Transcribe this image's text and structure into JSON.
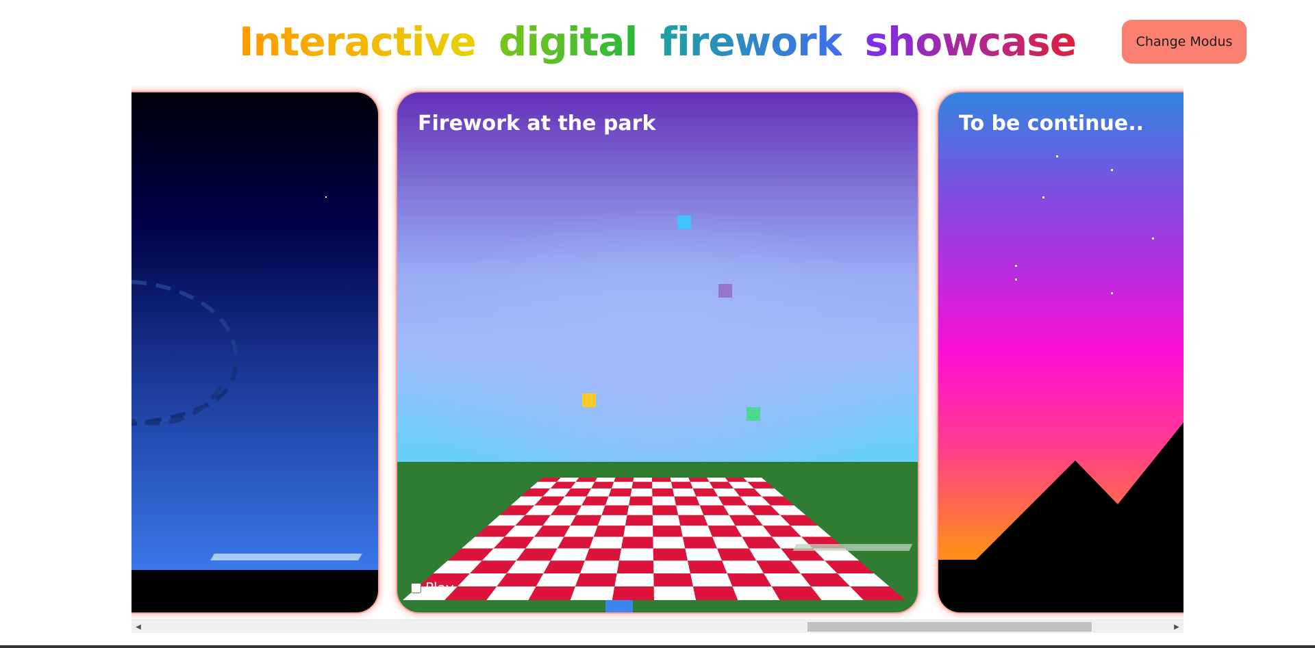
{
  "header": {
    "title_words": [
      {
        "text": "Interactive",
        "from": "#ff9a00",
        "to": "#e8d100"
      },
      {
        "text": "digital",
        "from": "#7cc41a",
        "to": "#2ab83c"
      },
      {
        "text": "firework",
        "from": "#1fa0a0",
        "to": "#3f6ff0"
      },
      {
        "text": "showcase",
        "from": "#7a2ff0",
        "to": "#e0203c"
      }
    ],
    "mode_button_label": "Change Modus",
    "mode_button_color": "#fa8072"
  },
  "cards": {
    "left": {
      "title": "",
      "sky_colors": [
        "#000008",
        "#01024a",
        "#1b3a98",
        "#3a78ea"
      ],
      "ground_color": "#000000"
    },
    "middle": {
      "title": "Firework at the park",
      "ground_color": "#2e7d32",
      "blanket_colors": [
        "#dc143c",
        "#ffffff"
      ],
      "particles": [
        {
          "color": "#40c4ff",
          "icon": "particle"
        },
        {
          "color": "#9575cd",
          "icon": "particle"
        },
        {
          "color": "#ffca28",
          "icon": "particle"
        },
        {
          "color": "#4cd890",
          "icon": "particle"
        }
      ],
      "play_label": "Play",
      "handle_color": "#3d85f0"
    },
    "right": {
      "title": "To be continue..",
      "mountain_color": "#000000"
    }
  },
  "scrollbar": {
    "left_arrow": "◀",
    "right_arrow": "▶"
  }
}
